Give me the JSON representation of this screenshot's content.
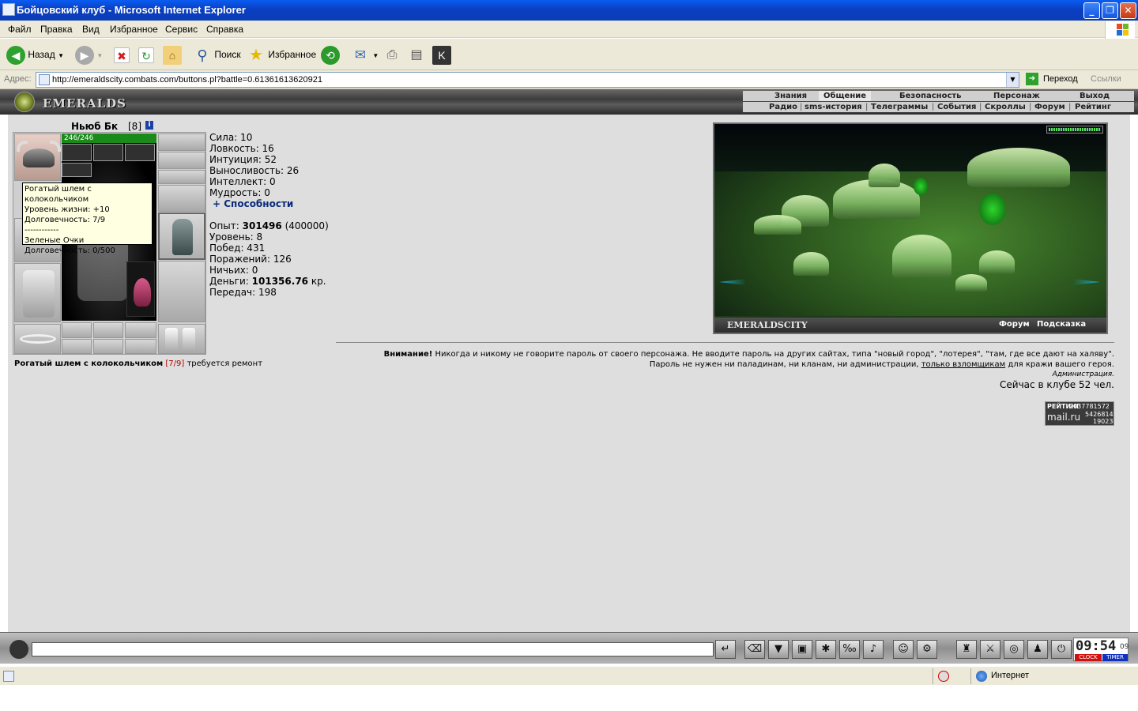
{
  "window": {
    "title": "Бойцовский клуб - Microsoft Internet Explorer"
  },
  "menu": [
    "Файл",
    "Правка",
    "Вид",
    "Избранное",
    "Сервис",
    "Справка"
  ],
  "toolbar": {
    "back": "Назад",
    "search": "Поиск",
    "favorites": "Избранное"
  },
  "address": {
    "label": "Адрес:",
    "url": "http://emeraldscity.combats.com/buttons.pl?battle=0.61361613620921",
    "go": "Переход",
    "links": "Ссылки"
  },
  "game_header": {
    "logo": "EMERALDS",
    "nav_top": [
      "Знания",
      "Общение",
      "Безопасность",
      "Персонаж",
      "Выход"
    ],
    "nav_bottom": [
      "Радио",
      "sms-история",
      "Телеграммы",
      "События",
      "Скроллы",
      "Форум",
      "Рейтинг"
    ]
  },
  "character": {
    "name": "Ньюб Бк",
    "level": "[8]",
    "hp": "246/246",
    "tooltip": [
      "Рогатый шлем с колокольчиком",
      "Уровень жизни: +10",
      "Долговечность: 7/9",
      "------------",
      "Зеленые Очки",
      "Долговечность: 0/500"
    ],
    "repair_item": "Рогатый шлем с колокольчиком",
    "repair_dur": "[7/9]",
    "repair_text": "требуется ремонт"
  },
  "stats": {
    "strength": "Сила: 10",
    "agility": "Ловкость: 16",
    "intuition": "Интуиция: 52",
    "stamina": "Выносливость: 26",
    "intellect": "Интеллект: 0",
    "wisdom": "Мудрость: 0",
    "abilities": "+ Способности",
    "exp_label": "Опыт:",
    "exp_value": "301496",
    "exp_next": "(400000)",
    "level": "Уровень: 8",
    "wins": "Побед: 431",
    "losses": "Поражений: 126",
    "draws": "Ничьих: 0",
    "money_label": "Деньги:",
    "money_value": "101356.76",
    "money_unit": "кр.",
    "transfers": "Передач: 198"
  },
  "map": {
    "brand": "EMERALDSCITY",
    "forum": "Форум",
    "hint": "Подсказка"
  },
  "warning": {
    "bold": "Внимание!",
    "line1": "Никогда и никому не говорите пароль от своего персонажа. Не вводите пароль на других сайтах, типа \"новый город\", \"лотерея\", \"там, где все дают на халяву\".",
    "line2a": "Пароль не нужен ни паладинам, ни кланам, ни администрации,",
    "line2link": "только взломщикам",
    "line2b": "для кражи вашего героя.",
    "admin": "Администрация.",
    "online": "Сейчас в клубе 52 чел."
  },
  "counter": {
    "label": "РЕЙТИНГ",
    "brand": "mail.ru",
    "n1": "2037781572",
    "n2": "5426814",
    "n3": "19023"
  },
  "clock": {
    "time": "09:54",
    "sec": "09",
    "clock_label": "CLOCK",
    "timer_label": "TIMER"
  },
  "status": {
    "zone": "Интернет"
  }
}
